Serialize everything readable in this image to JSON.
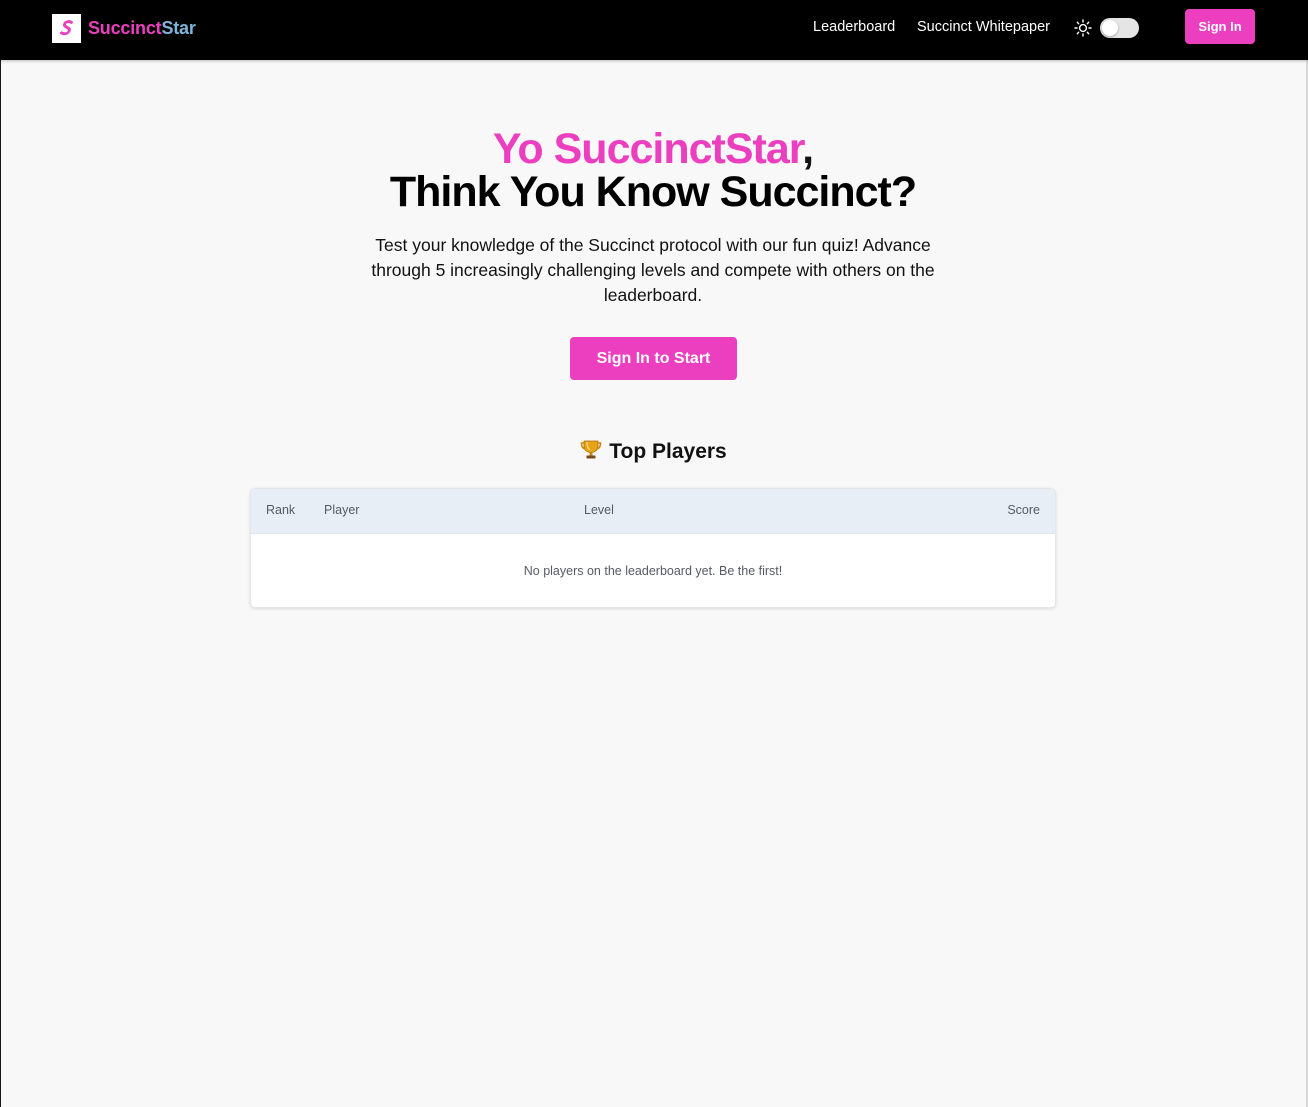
{
  "nav": {
    "brand_part1": "Succinct",
    "brand_part2": "Star",
    "links": [
      "Leaderboard",
      "Succinct Whitepaper"
    ],
    "theme_toggle_icon": "sun-icon",
    "signin_label": "Sign In"
  },
  "hero": {
    "greeting": "Yo SuccinctStar",
    "comma": ",",
    "headline": "Think You Know Succinct?",
    "description": "Test your knowledge of the Succinct protocol with our fun quiz! Advance through 5 increasingly challenging levels and compete with others on the leaderboard.",
    "cta_label": "Sign In to Start"
  },
  "leaderboard": {
    "icon": "trophy-icon",
    "title": "Top Players",
    "columns": [
      "Rank",
      "Player",
      "Level",
      "Score"
    ],
    "empty_message": "No players on the leaderboard yet. Be the first!"
  },
  "colors": {
    "accent": "#ec3fc0",
    "brand_secondary": "#7fb4d9",
    "navbar_bg": "#000000",
    "page_bg": "#f8f8f8",
    "table_header_bg": "#e7eef6"
  }
}
